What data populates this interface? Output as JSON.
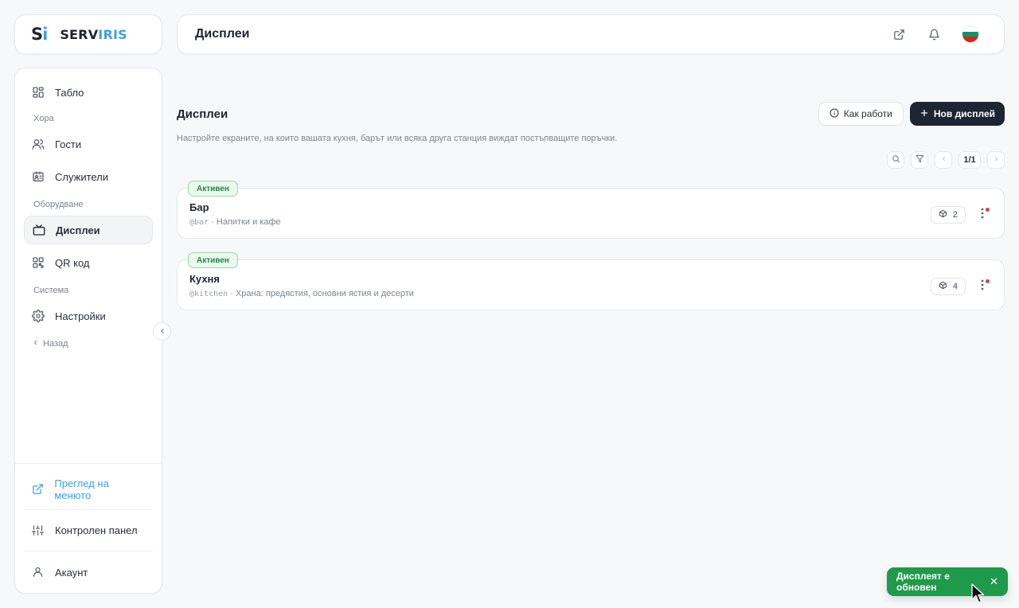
{
  "brand": {
    "mark_s": "S",
    "mark_i": "i",
    "name_a": "SERV",
    "name_b": "IRIS"
  },
  "topbar": {
    "title": "Дисплеи"
  },
  "sidebar": {
    "items": [
      {
        "label": "Табло",
        "icon": "dashboard-grid-icon"
      },
      {
        "section": "Хора"
      },
      {
        "label": "Гости",
        "icon": "users-icon"
      },
      {
        "label": "Служители",
        "icon": "id-card-icon"
      },
      {
        "section": "Оборудване"
      },
      {
        "label": "Дисплеи",
        "icon": "tv-icon",
        "active": true
      },
      {
        "label": "QR код",
        "icon": "qr-code-icon"
      },
      {
        "section": "Система"
      },
      {
        "label": "Настройки",
        "icon": "gear-icon"
      }
    ],
    "labels": {
      "tablo": "Табло",
      "people": "Хора",
      "guests": "Гости",
      "staff": "Служители",
      "equipment": "Оборудване",
      "displays": "Дисплеи",
      "qr": "QR код",
      "system": "Система",
      "settings": "Настройки",
      "back": "Назад"
    },
    "bottom": {
      "menu_preview": "Преглед на менюто",
      "control_panel": "Контролен панел",
      "account": "Акаунт"
    }
  },
  "main": {
    "title": "Дисплеи",
    "subtitle": "Настройте екраните, на които вашата кухня, барът или всяка друга станция виждат постъпващите поръчки.",
    "how_it_works": "Как работи",
    "new_display": "Нов дисплей",
    "pagination": "1/1",
    "displays": [
      {
        "status": "Активен",
        "name": "Бар",
        "slug": "@bar",
        "description": "Напитки и кафе",
        "count": "2"
      },
      {
        "status": "Активен",
        "name": "Кухня",
        "slug": "@kitchen",
        "description": "Храна: предястия, основни ястия и десерти",
        "count": "4"
      }
    ]
  },
  "toast": {
    "message": "Дисплеят е обновен"
  },
  "colors": {
    "accent": "#3aa0e8",
    "dark": "#1e2532",
    "success": "#1f9a4a",
    "badge_bg": "#eaf8ee",
    "alert_dot": "#e23b4a"
  }
}
